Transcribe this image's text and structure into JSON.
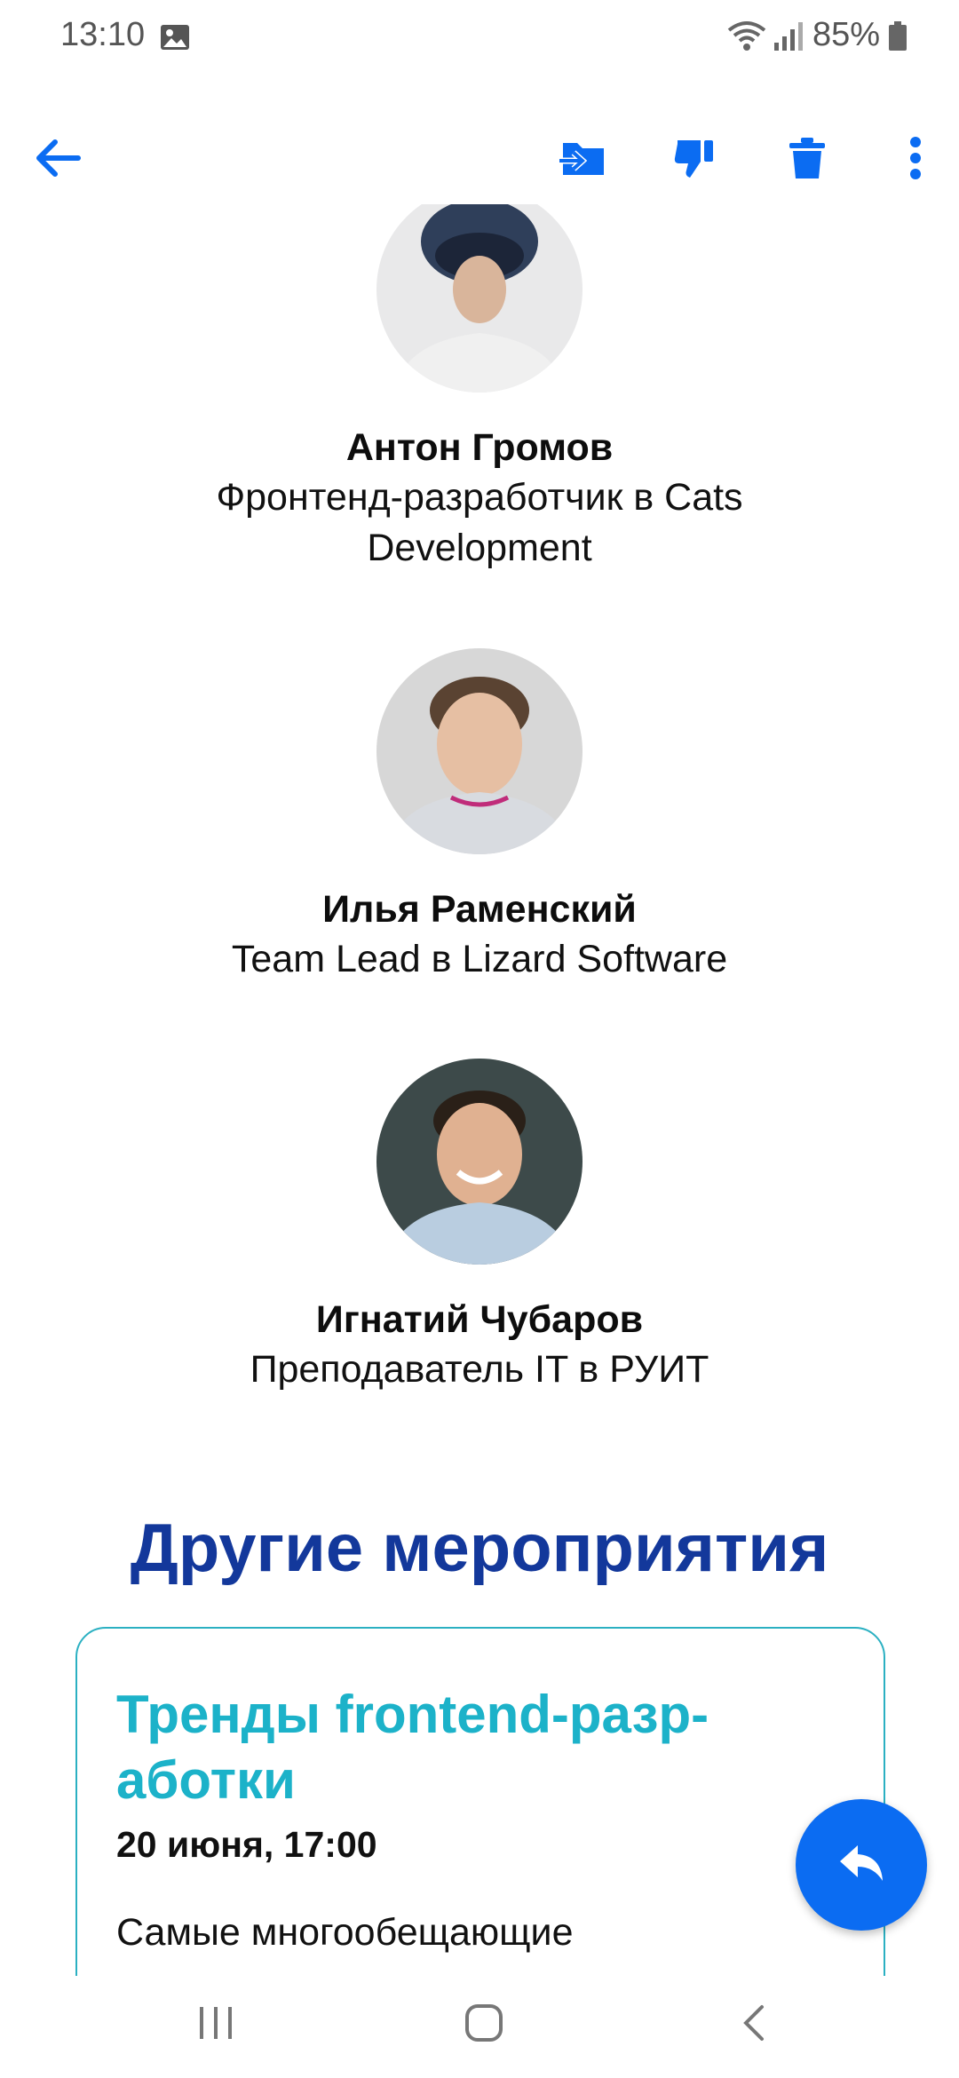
{
  "status_bar": {
    "time": "13:10",
    "battery": "85%",
    "icons": [
      "gallery-icon",
      "wifi-icon",
      "signal-icon",
      "battery-icon"
    ]
  },
  "toolbar": {
    "icons": [
      "back-arrow-icon",
      "move-to-folder-icon",
      "spam-thumbs-down-icon",
      "trash-icon",
      "more-vert-icon"
    ],
    "accent_color": "#0b6cf2"
  },
  "speakers": [
    {
      "name": "Антон Громов",
      "role": "Фронтенд-разработчик в Cats Development"
    },
    {
      "name": "Илья Раменский",
      "role": "Team Lead в Lizard Software"
    },
    {
      "name": "Игнатий Чубаров",
      "role": "Преподаватель IT в РУИТ"
    }
  ],
  "other_events": {
    "title": "Другие мероприятия",
    "title_color": "#13389b",
    "cards": [
      {
        "title": "Тренды frontend-разр-аботки",
        "date": "20 июня, 17:00",
        "description": "Самые многообещающие",
        "title_color": "#1cb2c9"
      }
    ]
  },
  "fab": {
    "icon": "reply-icon"
  },
  "nav_bar": {
    "icons": [
      "recents-icon",
      "home-icon",
      "back-icon"
    ]
  }
}
